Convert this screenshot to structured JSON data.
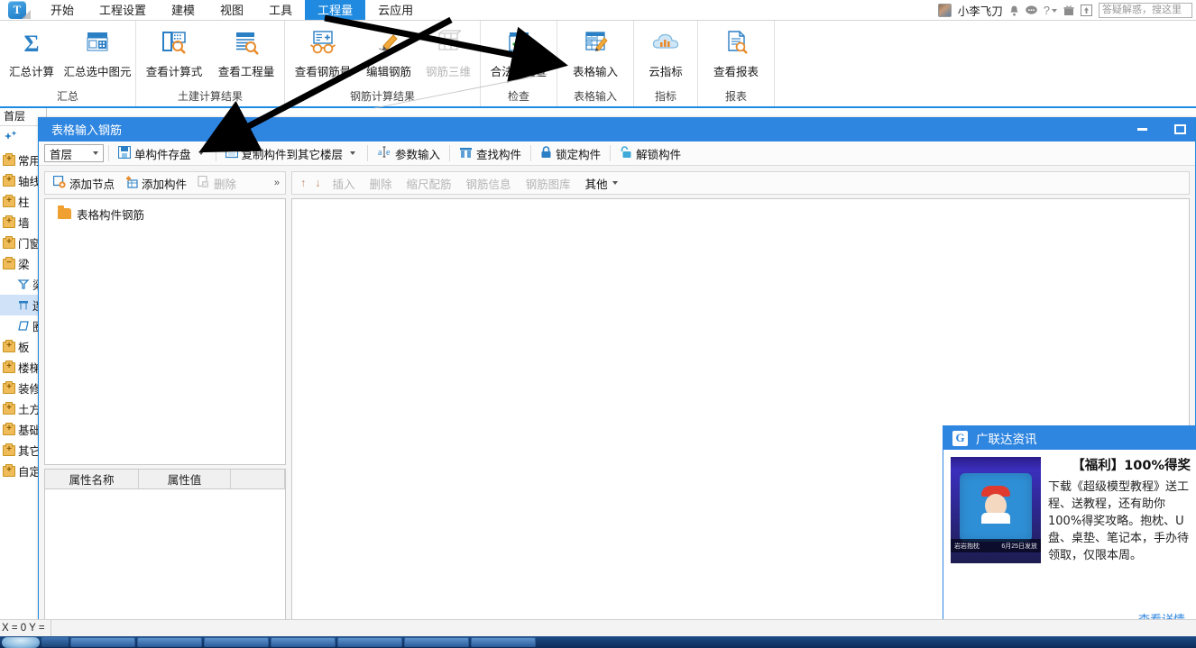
{
  "app": {
    "logo_text": "T",
    "tabs": [
      {
        "label": "开始",
        "active": false
      },
      {
        "label": "工程设置",
        "active": false
      },
      {
        "label": "建模",
        "active": false
      },
      {
        "label": "视图",
        "active": false
      },
      {
        "label": "工具",
        "active": false
      },
      {
        "label": "工程量",
        "active": true
      },
      {
        "label": "云应用",
        "active": false
      }
    ],
    "user": {
      "name": "小李飞刀",
      "icons": [
        "bell-icon",
        "message-icon",
        "help-icon",
        "gift-icon",
        "upload-icon"
      ]
    },
    "search": {
      "placeholder": "答疑解惑，搜这里",
      "value": ""
    }
  },
  "ribbon": {
    "groups": [
      {
        "label": "汇总",
        "buttons": [
          {
            "label": "汇总计算",
            "icon": "sigma-icon",
            "disabled": false
          },
          {
            "label": "汇总选中图元",
            "icon": "table-select-icon",
            "disabled": false
          }
        ]
      },
      {
        "label": "土建计算结果",
        "buttons": [
          {
            "label": "查看计算式",
            "icon": "formula-search-icon",
            "disabled": false
          },
          {
            "label": "查看工程量",
            "icon": "quantity-search-icon",
            "disabled": false
          }
        ]
      },
      {
        "label": "钢筋计算结果",
        "buttons": [
          {
            "label": "查看钢筋量",
            "icon": "rebar-glasses-icon",
            "disabled": false
          },
          {
            "label": "编辑钢筋",
            "icon": "pencil-edit-icon",
            "disabled": false
          },
          {
            "label": "钢筋三维",
            "icon": "rebar-3d-icon",
            "disabled": true
          }
        ]
      },
      {
        "label": "检查",
        "buttons": [
          {
            "label": "合法性检查",
            "icon": "checkmark-icon",
            "disabled": false
          }
        ]
      },
      {
        "label": "表格输入",
        "buttons": [
          {
            "label": "表格输入",
            "icon": "table-edit-icon",
            "disabled": false
          }
        ]
      },
      {
        "label": "指标",
        "buttons": [
          {
            "label": "云指标",
            "icon": "cloud-chart-icon",
            "disabled": false
          }
        ]
      },
      {
        "label": "报表",
        "buttons": [
          {
            "label": "查看报表",
            "icon": "report-search-icon",
            "disabled": false
          }
        ]
      }
    ]
  },
  "sidebar": {
    "floor": "首层",
    "items": [
      {
        "label": "常用构",
        "icon": "folder-closed-icon",
        "level": 0,
        "selected": false,
        "expanded": false
      },
      {
        "label": "轴线",
        "icon": "folder-closed-icon",
        "level": 0,
        "selected": false,
        "expanded": false
      },
      {
        "label": "柱",
        "icon": "folder-closed-icon",
        "level": 0,
        "selected": false,
        "expanded": false
      },
      {
        "label": "墙",
        "icon": "folder-closed-icon",
        "level": 0,
        "selected": false,
        "expanded": false
      },
      {
        "label": "门窗洞",
        "icon": "folder-closed-icon",
        "level": 0,
        "selected": false,
        "expanded": false
      },
      {
        "label": "梁",
        "icon": "folder-open-icon",
        "level": 0,
        "selected": false,
        "expanded": true
      },
      {
        "label": "梁",
        "icon": "beam-icon",
        "level": 1,
        "selected": false,
        "expanded": false
      },
      {
        "label": "连",
        "icon": "coupling-beam-icon",
        "level": 1,
        "selected": true,
        "expanded": false
      },
      {
        "label": "圈",
        "icon": "ring-beam-icon",
        "level": 1,
        "selected": false,
        "expanded": false
      },
      {
        "label": "板",
        "icon": "folder-closed-icon",
        "level": 0,
        "selected": false,
        "expanded": false
      },
      {
        "label": "楼梯",
        "icon": "folder-closed-icon",
        "level": 0,
        "selected": false,
        "expanded": false
      },
      {
        "label": "装修",
        "icon": "folder-closed-icon",
        "level": 0,
        "selected": false,
        "expanded": false
      },
      {
        "label": "土方",
        "icon": "folder-closed-icon",
        "level": 0,
        "selected": false,
        "expanded": false
      },
      {
        "label": "基础",
        "icon": "folder-closed-icon",
        "level": 0,
        "selected": false,
        "expanded": false
      },
      {
        "label": "其它",
        "icon": "folder-closed-icon",
        "level": 0,
        "selected": false,
        "expanded": false
      },
      {
        "label": "自定义",
        "icon": "folder-closed-icon",
        "level": 0,
        "selected": false,
        "expanded": false
      }
    ]
  },
  "dialog": {
    "title": "表格输入钢筋",
    "window_buttons": [
      "minimize-button",
      "maximize-button"
    ],
    "toolbar": {
      "floor_select": "首层",
      "buttons": [
        {
          "label": "单构件存盘",
          "icon": "save-component-icon",
          "dropdown": true,
          "disabled": false
        },
        {
          "label": "复制构件到其它楼层",
          "icon": "copy-component-icon",
          "dropdown": true,
          "disabled": false
        },
        {
          "label": "参数输入",
          "icon": "parameter-input-icon",
          "dropdown": false,
          "disabled": false
        },
        {
          "label": "查找构件",
          "icon": "find-component-icon",
          "dropdown": false,
          "disabled": false
        },
        {
          "label": "锁定构件",
          "icon": "lock-icon",
          "dropdown": false,
          "disabled": false
        },
        {
          "label": "解锁构件",
          "icon": "unlock-icon",
          "dropdown": false,
          "disabled": false
        }
      ]
    },
    "left_panel": {
      "toolbar": [
        {
          "label": "添加节点",
          "icon": "add-node-icon",
          "disabled": false
        },
        {
          "label": "添加构件",
          "icon": "add-component-icon",
          "disabled": false
        },
        {
          "label": "删除",
          "icon": "delete-icon",
          "disabled": true
        }
      ],
      "overflow": "»",
      "tree": [
        {
          "label": "表格构件钢筋",
          "icon": "folder-open-orange-icon"
        }
      ],
      "property_grid": {
        "columns": [
          "属性名称",
          "属性值",
          ""
        ],
        "rows": []
      }
    },
    "right_panel": {
      "toolbar": [
        {
          "label": "↑",
          "name": "move-up-button",
          "disabled": true
        },
        {
          "label": "↓",
          "name": "move-down-button",
          "disabled": true
        },
        {
          "label": "插入",
          "name": "insert-button",
          "disabled": true
        },
        {
          "label": "删除",
          "name": "delete-row-button",
          "disabled": true
        },
        {
          "label": "缩尺配筋",
          "name": "scale-rebar-button",
          "disabled": true
        },
        {
          "label": "钢筋信息",
          "name": "rebar-info-button",
          "disabled": true
        },
        {
          "label": "钢筋图库",
          "name": "rebar-library-button",
          "disabled": true
        },
        {
          "label": "其他",
          "name": "other-button",
          "disabled": false,
          "dropdown": true
        }
      ],
      "grid_rows": []
    }
  },
  "ad": {
    "header": "广联达资讯",
    "logo": "G",
    "title": "【福利】100%得奖",
    "body": "下载《超级模型教程》送工程、送教程，还有助你100%得奖攻略。抱枕、U盘、桌垫、笔记本，手办待领取，仅限本周。",
    "thumb_caption_left": "岩岩抱枕",
    "thumb_caption_right": "6月25日发放",
    "link": "查看详情"
  },
  "status": {
    "coordinates": "X = 0 Y ="
  },
  "colors": {
    "accent": "#2f86e0",
    "tab_active_bg": "#1f8ae0",
    "ribbon_icon_blue": "#1f7cc6",
    "ribbon_icon_orange": "#e98b2a",
    "selection": "#cfe2f7",
    "disabled_text": "#b5b5b5"
  }
}
